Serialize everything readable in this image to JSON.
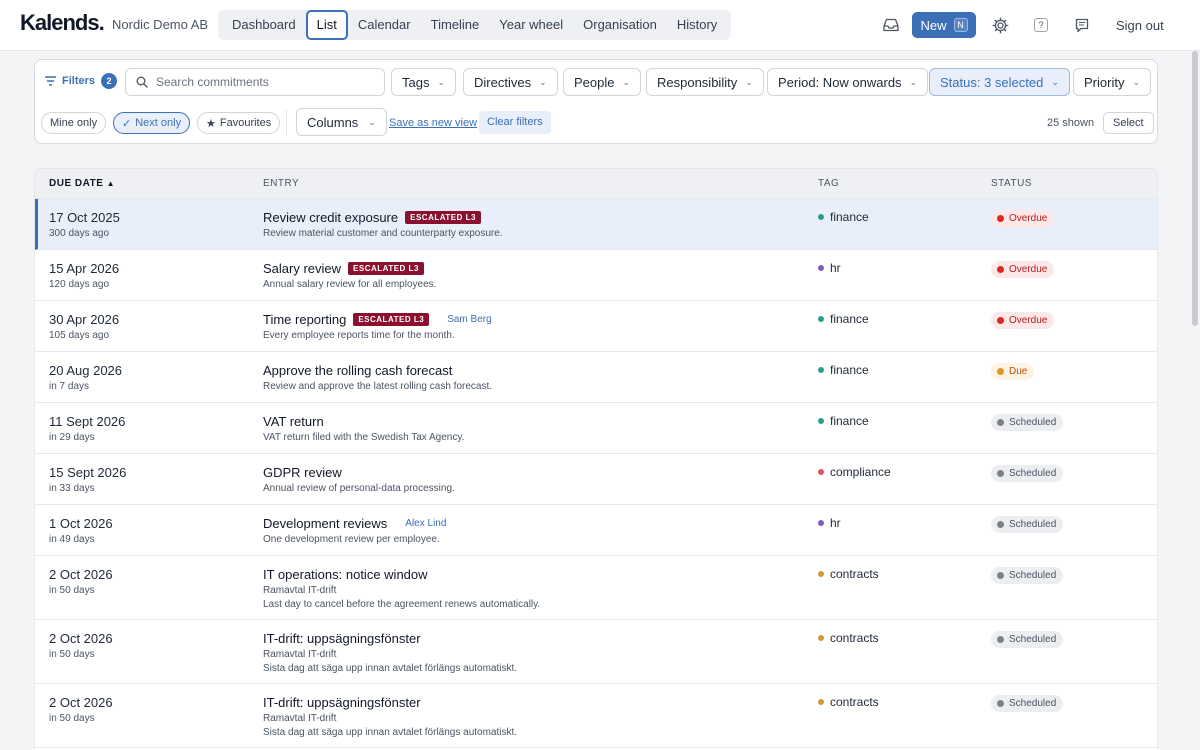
{
  "app": {
    "logo": "Kalends.",
    "org": "Nordic Demo AB",
    "nav": [
      "Dashboard",
      "List",
      "Calendar",
      "Timeline",
      "Year wheel",
      "Organisation",
      "History"
    ],
    "active_nav": "List",
    "new_label": "New",
    "new_shortcut": "N",
    "help_glyph": "?",
    "sign_out": "Sign out"
  },
  "filters": {
    "label": "Filters",
    "count": "2",
    "search_placeholder": "Search commitments",
    "tags": "Tags",
    "directives": "Directives",
    "people": "People",
    "responsibility": "Responsibility",
    "period": "Period: Now onwards",
    "status": "Status: 3 selected",
    "priority": "Priority",
    "mine_only": "Mine only",
    "next_only": "Next only",
    "favourites": "Favourites",
    "columns": "Columns",
    "save_view": "Save as new view",
    "clear": "Clear filters",
    "shown": "25 shown",
    "select": "Select"
  },
  "table": {
    "headers": {
      "due": "DUE DATE",
      "entry": "ENTRY",
      "tag": "TAG",
      "status": "STATUS"
    },
    "sort_indicator": "▲",
    "rows": [
      {
        "date": "17 Oct 2025",
        "rel": "300 days ago",
        "title": "Review credit exposure",
        "badge": "ESCALATED L3",
        "owner": "",
        "sub": "",
        "desc": "Review material customer and counterparty exposure.",
        "tag": "finance",
        "status": "Overdue"
      },
      {
        "date": "15 Apr 2026",
        "rel": "120 days ago",
        "title": "Salary review",
        "badge": "ESCALATED L3",
        "owner": "",
        "sub": "",
        "desc": "Annual salary review for all employees.",
        "tag": "hr",
        "status": "Overdue"
      },
      {
        "date": "30 Apr 2026",
        "rel": "105 days ago",
        "title": "Time reporting",
        "badge": "ESCALATED L3",
        "owner": "Sam Berg",
        "sub": "",
        "desc": "Every employee reports time for the month.",
        "tag": "finance",
        "status": "Overdue"
      },
      {
        "date": "20 Aug 2026",
        "rel": "in 7 days",
        "title": "Approve the rolling cash forecast",
        "badge": "",
        "owner": "",
        "sub": "",
        "desc": "Review and approve the latest rolling cash forecast.",
        "tag": "finance",
        "status": "Due"
      },
      {
        "date": "11 Sept 2026",
        "rel": "in 29 days",
        "title": "VAT return",
        "badge": "",
        "owner": "",
        "sub": "",
        "desc": "VAT return filed with the Swedish Tax Agency.",
        "tag": "finance",
        "status": "Scheduled"
      },
      {
        "date": "15 Sept 2026",
        "rel": "in 33 days",
        "title": "GDPR review",
        "badge": "",
        "owner": "",
        "sub": "",
        "desc": "Annual review of personal-data processing.",
        "tag": "compliance",
        "status": "Scheduled"
      },
      {
        "date": "1 Oct 2026",
        "rel": "in 49 days",
        "title": "Development reviews",
        "badge": "",
        "owner": "Alex Lind",
        "sub": "",
        "desc": "One development review per employee.",
        "tag": "hr",
        "status": "Scheduled"
      },
      {
        "date": "2 Oct 2026",
        "rel": "in 50 days",
        "title": "IT operations: notice window",
        "badge": "",
        "owner": "",
        "sub": "Ramavtal IT-drift",
        "desc": "Last day to cancel before the agreement renews automatically.",
        "tag": "contracts",
        "status": "Scheduled"
      },
      {
        "date": "2 Oct 2026",
        "rel": "in 50 days",
        "title": "IT-drift: uppsägningsfönster",
        "badge": "",
        "owner": "",
        "sub": "Ramavtal IT-drift",
        "desc": "Sista dag att säga upp innan avtalet förlängs automatiskt.",
        "tag": "contracts",
        "status": "Scheduled"
      },
      {
        "date": "2 Oct 2026",
        "rel": "in 50 days",
        "title": "IT-drift: uppsägningsfönster",
        "badge": "",
        "owner": "",
        "sub": "Ramavtal IT-drift",
        "desc": "Sista dag att säga upp innan avtalet förlängs automatiskt.",
        "tag": "contracts",
        "status": "Scheduled"
      }
    ]
  },
  "tag_colors": {
    "finance": "#2a9d8f",
    "hr": "#7c5cc4",
    "compliance": "#e05263",
    "contracts": "#d19a3a"
  },
  "colors": {
    "accent": "#3b6fb6",
    "escalated": "#8b1030"
  }
}
